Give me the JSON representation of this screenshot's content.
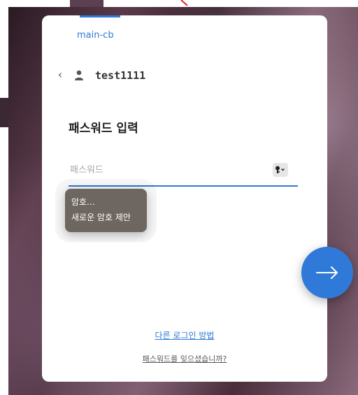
{
  "account": {
    "name": "main-cb"
  },
  "user": {
    "username": "test1111"
  },
  "form": {
    "heading": "패스워드 입력",
    "password_placeholder": "패스워드",
    "password_value": ""
  },
  "autofill": {
    "item1": "암호...",
    "item2": "새로운 암호 제안"
  },
  "links": {
    "other_login": "다른 로그인 방법",
    "forgot": "패스워드를 잊으셨습니까?"
  },
  "colors": {
    "accent": "#2f7ad8",
    "suggest_bg": "#6e6660"
  },
  "icons": {
    "back": "chevron-left-icon",
    "user": "user-icon",
    "key": "key-icon",
    "next": "arrow-right-icon"
  }
}
